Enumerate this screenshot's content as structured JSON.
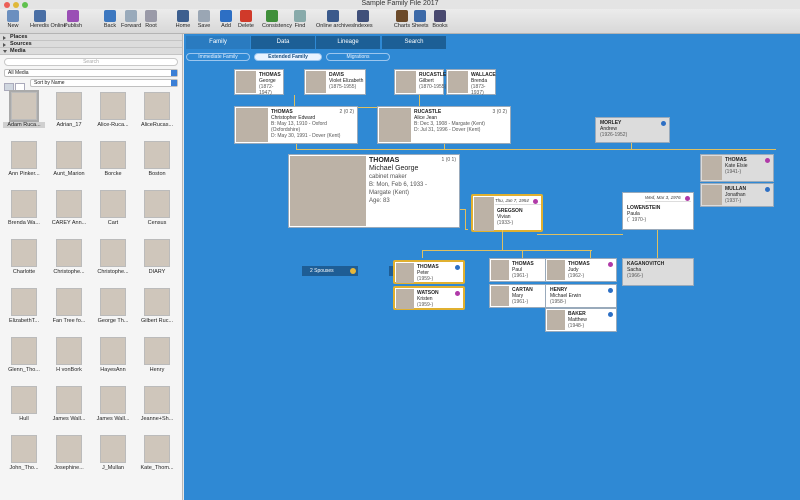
{
  "app": {
    "title": "Sample Family File 2017"
  },
  "toolbar": {
    "items": [
      {
        "label": "New",
        "icon": "new-file-icon",
        "color": "#6b8fbf"
      },
      {
        "label": "Heredis Online",
        "icon": "heredis-online-icon",
        "color": "#4a6fa5"
      },
      {
        "label": "Publish",
        "icon": "publish-icon",
        "color": "#9a4fb5"
      },
      {
        "label": "Back",
        "icon": "back-arrow-icon",
        "color": "#3d78c0"
      },
      {
        "label": "Forward",
        "icon": "forward-arrow-icon",
        "color": "#9ab"
      },
      {
        "label": "Root",
        "icon": "root-icon",
        "color": "#9a9aa8"
      },
      {
        "label": "Home",
        "icon": "home-icon",
        "color": "#3d5f8f"
      },
      {
        "label": "Save",
        "icon": "save-icon",
        "color": "#9aa6b4"
      },
      {
        "label": "Add",
        "icon": "add-icon",
        "color": "#2d6fc4"
      },
      {
        "label": "Delete",
        "icon": "delete-icon",
        "color": "#d03a2a"
      },
      {
        "label": "Consistency",
        "icon": "consistency-icon",
        "color": "#3f8f3a"
      },
      {
        "label": "Find",
        "icon": "find-icon",
        "color": "#8aa"
      },
      {
        "label": "Online archives",
        "icon": "online-archives-icon",
        "color": "#3b5a8c"
      },
      {
        "label": "Indexes",
        "icon": "indexes-icon",
        "color": "#40507a"
      },
      {
        "label": "Charts",
        "icon": "charts-icon",
        "color": "#6b4a2a"
      },
      {
        "label": "Sheets",
        "icon": "sheets-icon",
        "color": "#3d6aa8"
      },
      {
        "label": "Books",
        "icon": "books-icon",
        "color": "#4a4a70"
      }
    ]
  },
  "sidebar": {
    "sections": [
      "Places",
      "Sources",
      "Media"
    ],
    "search_placeholder": "Search",
    "filter": "All Media",
    "sort": "Sort by Name",
    "media": [
      "Adam Ruca...",
      "Adrian_17",
      "Alice-Ruca...",
      "AliceRucas...",
      "Ann Pinker...",
      "Aunt_Marion",
      "Borcke",
      "Boston",
      "Brenda Wa...",
      "CAREY Ann...",
      "Cart",
      "Census",
      "Charlotte",
      "Christophe...",
      "Christophe...",
      "DIARY",
      "ElizabethT...",
      "Fan Tree fo...",
      "George Th...",
      "Gilbert Ruc...",
      "Glenn_Tho...",
      "H vonBork",
      "HayesAnn",
      "Henry",
      "Hull",
      "James Wall...",
      "James Wall...",
      "Jeanne+Sh...",
      "John_Tho...",
      "Josephine...",
      "J_Mullan",
      "Kate_Thom..."
    ]
  },
  "tabs": [
    "Family",
    "Data",
    "Lineage",
    "Search"
  ],
  "subtabs": [
    "Immediate Family",
    "Extended Family",
    "Migrations"
  ],
  "tree": {
    "gp": [
      {
        "surname": "THOMAS",
        "given": "George",
        "dates": "(1872-1947)"
      },
      {
        "surname": "DAVIS",
        "given": "Violet Elizabeth",
        "dates": "(1875-1955)"
      },
      {
        "surname": "RUCASTLE",
        "given": "Gilbert",
        "dates": "(1870-1955)"
      },
      {
        "surname": "WALLACE",
        "given": "Brenda",
        "dates": "(1873-1937)"
      }
    ],
    "father": {
      "surname": "THOMAS",
      "given": "Christopher Edward",
      "b": "B: May 13, 1910 - Oxford (Oxfordshire)",
      "d": "D: May 30, 1991 - Dover (Kent)",
      "count": "2 (0 2)"
    },
    "mother": {
      "surname": "RUCASTLE",
      "given": "Alice Jean",
      "b": "B: Dec 3, 1908 - Margate (Kent)",
      "d": "D: Jul 31, 1996 - Dover (Kent)",
      "count": "3 (0 2)"
    },
    "morley": {
      "surname": "MORLEY",
      "given": "Andrew",
      "dates": "(1926-1952)"
    },
    "main": {
      "surname": "THOMAS",
      "given": "Michael George",
      "occ": "cabinet maker",
      "b": "B: Mon, Feb 6, 1933 -",
      "place": "Margate (Kent)",
      "age": "Age: 83",
      "count": "1 (0 1)"
    },
    "spouses_label": "2 Spouses",
    "children_label": "3 Children",
    "sib": [
      {
        "surname": "THOMAS",
        "given": "Kate Elsie",
        "dates": "(1941-)"
      },
      {
        "surname": "MULLAN",
        "given": "Jonathan",
        "dates": "(1937-)"
      }
    ],
    "spouse1": {
      "event": "Thu, Jan 7, 1954",
      "surname": "GREGSON",
      "given": "Vivian",
      "dates": "(1933-)"
    },
    "spouse2": {
      "event": "Wed, Mar 3, 1976",
      "surname": "LOWENSTEIN",
      "given": "Paula",
      "dates": "(´ 1970-)"
    },
    "kaganovitch": {
      "surname": "KAGANOVITCH",
      "given": "Sacha",
      "dates": "(1966-)"
    },
    "kids": [
      {
        "surname": "THOMAS",
        "given": "Peter",
        "dates": "(1959-)",
        "spouse": {
          "surname": "WATSON",
          "given": "Kristen",
          "dates": "(1959-)"
        }
      },
      {
        "surname": "THOMAS",
        "given": "Paul",
        "dates": "(1961-)",
        "spouse": {
          "surname": "CARTAN",
          "given": "Mary",
          "dates": "(1961-)"
        }
      },
      {
        "surname": "THOMAS",
        "given": "Judy",
        "dates": "(1962-)",
        "spouse": {
          "surname": "HENRY",
          "given": "Michael Erwin",
          "dates": "(1958-)"
        },
        "spouse2": {
          "surname": "BAKER",
          "given": "Matthew",
          "dates": "(1948-)"
        }
      }
    ]
  }
}
